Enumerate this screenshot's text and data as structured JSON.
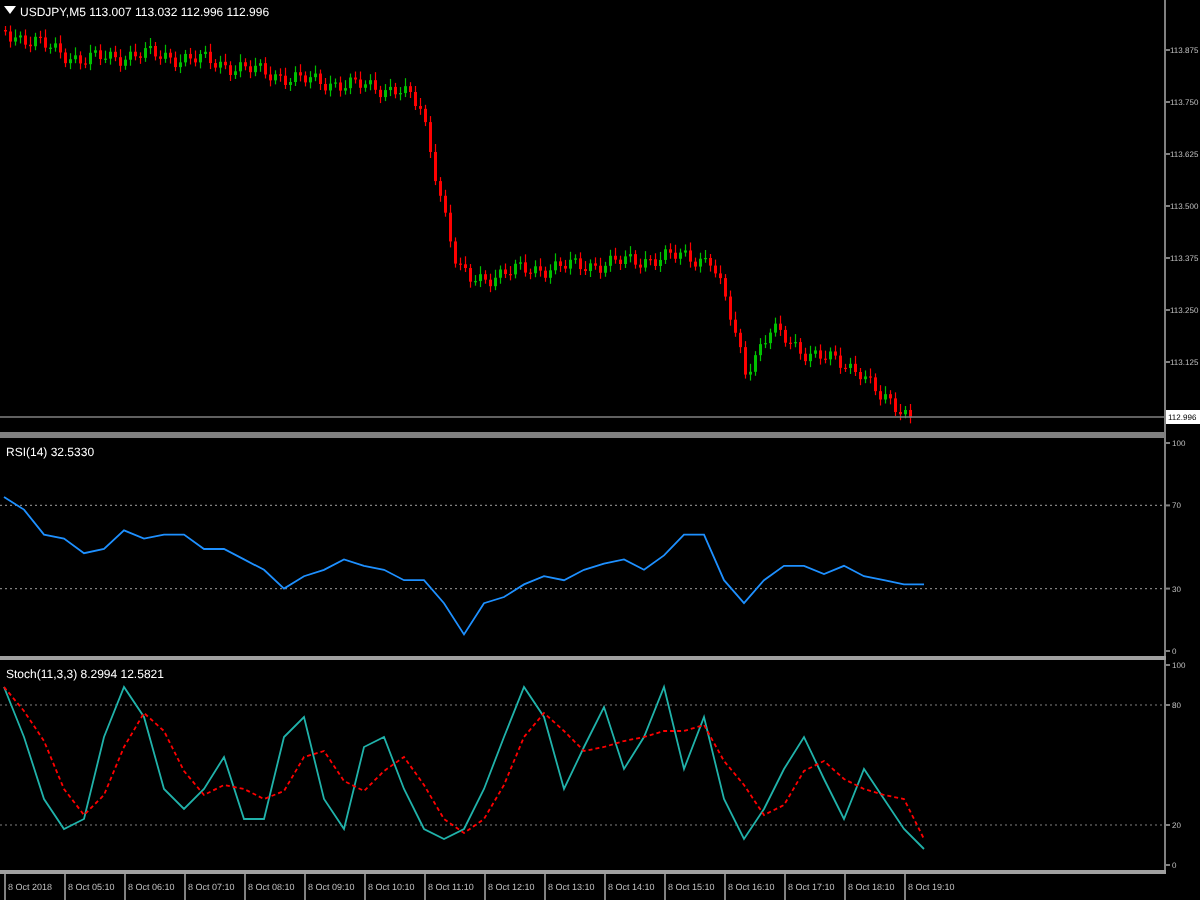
{
  "main_chart": {
    "legend": "USDJPY,M5 113.007 113.032 112.996 112.996",
    "price_ticks": [
      "113.875",
      "113.750",
      "113.625",
      "113.500",
      "113.375",
      "113.250",
      "113.125"
    ],
    "current_price": "112.996"
  },
  "rsi": {
    "label": "RSI(14) 32.5330",
    "chart_data": {
      "type": "line",
      "ylim": [
        0,
        100
      ],
      "yticks": [
        0,
        30,
        70,
        100
      ],
      "series": [
        {
          "color": "#1e90ff",
          "values": [
            74,
            68,
            56,
            54,
            47,
            49,
            58,
            54,
            56,
            56,
            49,
            49,
            44,
            39,
            30,
            36,
            39,
            44,
            41,
            39,
            34,
            34,
            23,
            8,
            23,
            26,
            32,
            36,
            34,
            39,
            42,
            44,
            39,
            46,
            56,
            56,
            34,
            23,
            34,
            41,
            41,
            37,
            41,
            36,
            34,
            32,
            32
          ]
        }
      ]
    }
  },
  "stochastic": {
    "label": "Stoch(11,3,3) 8.2994 12.5821",
    "chart_data": {
      "type": "line",
      "ylim": [
        0,
        100
      ],
      "yticks": [
        0,
        20,
        80,
        100
      ],
      "series": [
        {
          "color": "#20b2aa",
          "values": [
            89,
            64,
            33,
            18,
            23,
            64,
            89,
            74,
            38,
            28,
            38,
            54,
            23,
            23,
            64,
            74,
            33,
            18,
            59,
            64,
            38,
            18,
            13,
            18,
            38,
            64,
            89,
            74,
            38,
            59,
            79,
            48,
            64,
            89,
            48,
            74,
            33,
            13,
            28,
            48,
            64,
            43,
            23,
            48,
            33,
            18,
            8
          ]
        },
        {
          "color": "#ff0000",
          "line_style": "dashed",
          "values": [
            89,
            77,
            62,
            38,
            25,
            35,
            59,
            76,
            67,
            47,
            35,
            40,
            38,
            33,
            37,
            54,
            57,
            42,
            37,
            47,
            54,
            40,
            23,
            16,
            23,
            40,
            64,
            76,
            67,
            57,
            59,
            62,
            64,
            67,
            67,
            70,
            52,
            40,
            25,
            30,
            47,
            52,
            43,
            38,
            35,
            33,
            13
          ]
        }
      ]
    }
  },
  "time_axis": [
    "8 Oct 2018",
    "8 Oct 05:10",
    "8 Oct 06:10",
    "8 Oct 07:10",
    "8 Oct 08:10",
    "8 Oct 09:10",
    "8 Oct 10:10",
    "8 Oct 11:10",
    "8 Oct 12:10",
    "8 Oct 13:10",
    "8 Oct 14:10",
    "8 Oct 15:10",
    "8 Oct 16:10",
    "8 Oct 17:10",
    "8 Oct 18:10",
    "8 Oct 19:10"
  ]
}
